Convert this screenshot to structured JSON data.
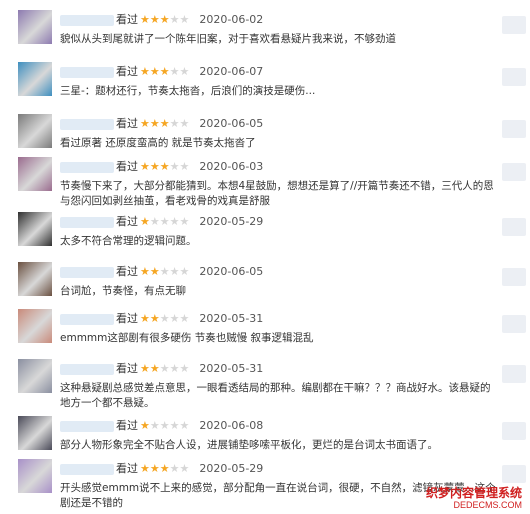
{
  "comments": [
    {
      "action": "看过",
      "rating": 3,
      "date": "2020-06-02",
      "text": "貌似从头到尾就讲了一个陈年旧案，对于喜欢看悬疑片我来说，不够劲道",
      "avatar_color": "#8d7ab0"
    },
    {
      "action": "看过",
      "rating": 3,
      "date": "2020-06-07",
      "text": "三星-：题材还行，节奏太拖沓，后浪们的演技是硬伤...",
      "avatar_color": "#3e8fbf"
    },
    {
      "action": "看过",
      "rating": 3,
      "date": "2020-06-05",
      "text": "看过原著 还原度蛮高的 就是节奏太拖沓了",
      "avatar_color": "#7a7a7a"
    },
    {
      "action": "看过",
      "rating": 3,
      "date": "2020-06-03",
      "text": "节奏慢下来了，大部分都能猜到。本想4星鼓励，想想还是算了//开篇节奏还不错，三代人的恩与怨闪回如剥丝抽茧，看老戏骨的戏真是舒服",
      "avatar_color": "#9a6b8e"
    },
    {
      "action": "看过",
      "rating": 1,
      "date": "2020-05-29",
      "text": "太多不符合常理的逻辑问题。",
      "avatar_color": "#2f2f2f"
    },
    {
      "action": "看过",
      "rating": 2,
      "date": "2020-06-05",
      "text": "台词尬，节奏怪，有点无聊",
      "avatar_color": "#6a5040"
    },
    {
      "action": "看过",
      "rating": 2,
      "date": "2020-05-31",
      "text": "emmmm这部剧有很多硬伤 节奏也贼慢 叙事逻辑混乱",
      "avatar_color": "#c98a7a"
    },
    {
      "action": "看过",
      "rating": 2,
      "date": "2020-05-31",
      "text": "这种悬疑剧总感觉差点意思，一眼看透结局的那种。编剧都在干嘛？？？商战好水。该悬疑的地方一个都不悬疑。",
      "avatar_color": "#8a8fa0"
    },
    {
      "action": "看过",
      "rating": 1,
      "date": "2020-06-08",
      "text": "部分人物形象完全不贴合人设，进展铺垫哆嗦平板化，更烂的是台词太书面语了。",
      "avatar_color": "#4a4a58"
    },
    {
      "action": "看过",
      "rating": 3,
      "date": "2020-05-29",
      "text": "开头感觉emmm说不上来的感觉，部分配角一直在说台词，很硬，不自然，滤镜灰蒙蒙...这个剧还是不错的",
      "avatar_color": "#a890c8"
    }
  ],
  "stars": {
    "full": "★",
    "empty": "★"
  },
  "watermark": {
    "line1": "织梦内容管理系统",
    "line2": "DEDECMS.COM"
  }
}
